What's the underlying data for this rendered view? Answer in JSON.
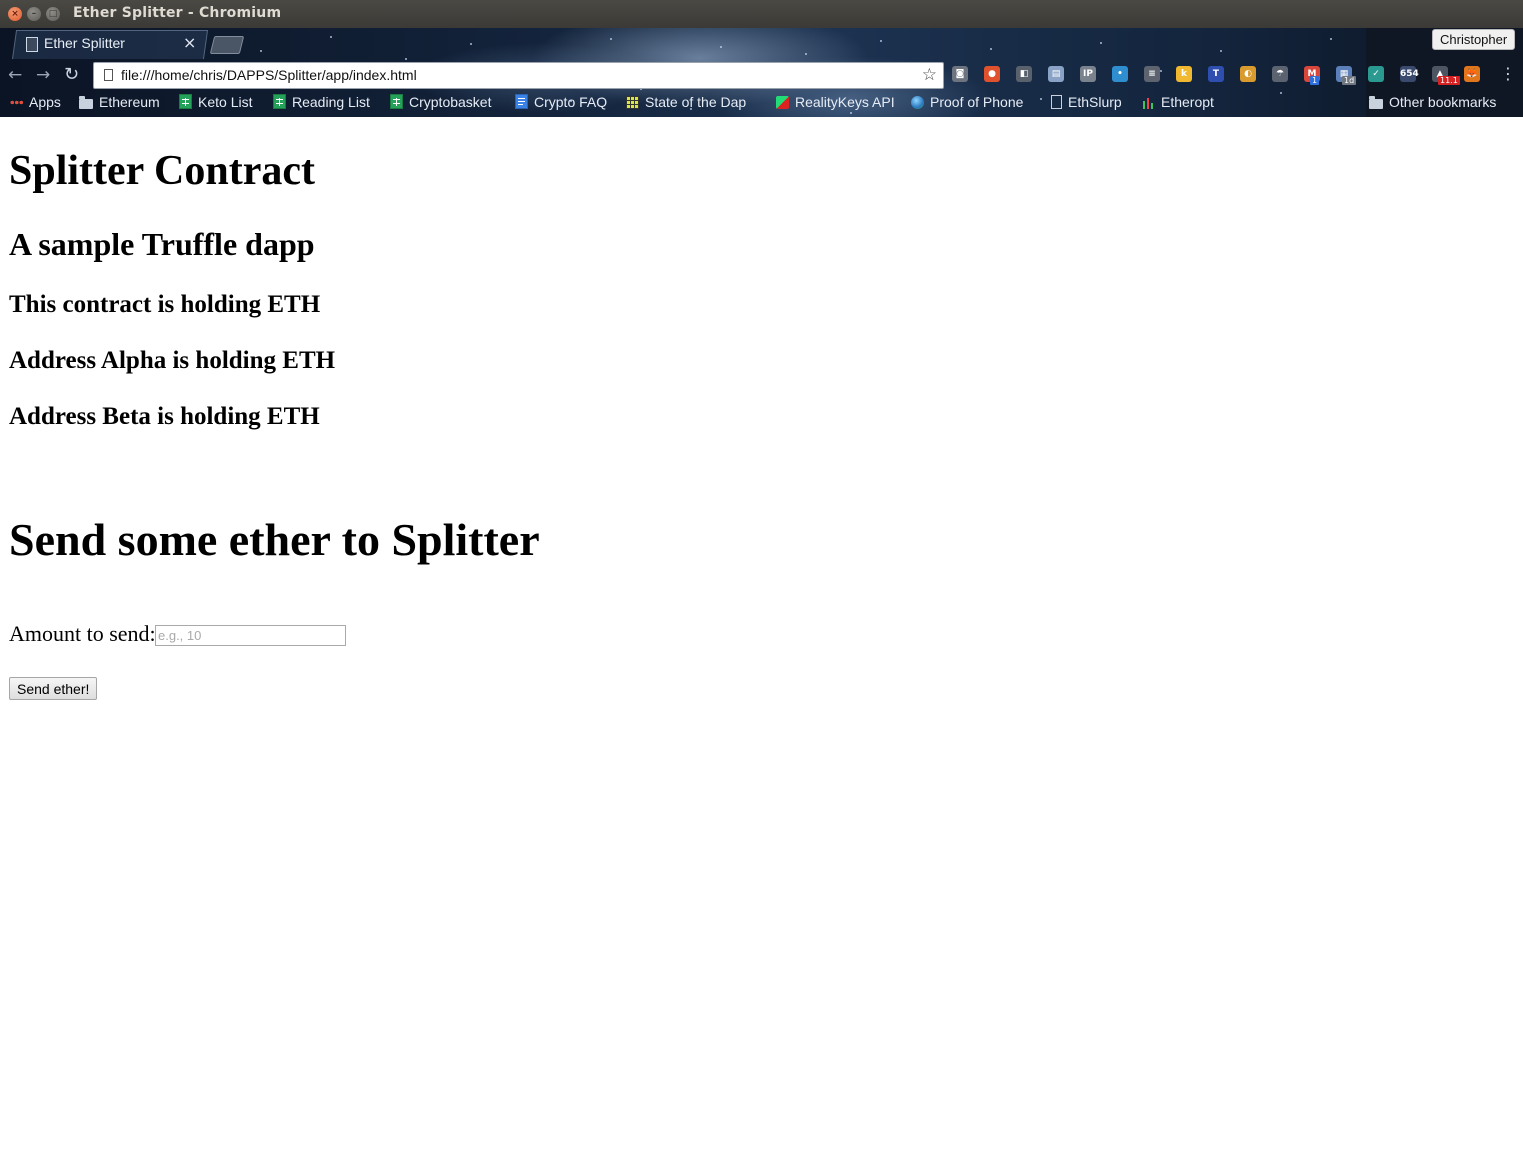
{
  "window": {
    "title": "Ether Splitter - Chromium",
    "controls": {
      "close": "×",
      "minimize": "–",
      "maximize": "□"
    }
  },
  "browser": {
    "tab": {
      "title": "Ether Splitter",
      "close_glyph": "×"
    },
    "profile_name": "Christopher",
    "address_bar": {
      "url": "file:///home/chris/DAPPS/Splitter/app/index.html"
    },
    "nav": {
      "back": "←",
      "forward": "→",
      "reload": "↻",
      "star": "☆",
      "menu": "⋮"
    },
    "extensions": [
      {
        "name": "pocket-icon",
        "glyph": "◙",
        "color": "#6d7480"
      },
      {
        "name": "brave-icon",
        "glyph": "●",
        "color": "#e0522e"
      },
      {
        "name": "reader-icon",
        "glyph": "◧",
        "color": "#59616d"
      },
      {
        "name": "doc-icon",
        "glyph": "▤",
        "color": "#8aa2c6"
      },
      {
        "name": "ip-icon",
        "glyph": "IP",
        "color": "#7a828e"
      },
      {
        "name": "dot-icon",
        "glyph": "•",
        "color": "#2f8ecf"
      },
      {
        "name": "database-icon",
        "glyph": "≡",
        "color": "#5d6470"
      },
      {
        "name": "keep-icon",
        "glyph": "k",
        "color": "#f0b930"
      },
      {
        "name": "trello-icon",
        "glyph": "T",
        "color": "#2f4fb0"
      },
      {
        "name": "color-wheel-icon",
        "glyph": "◐",
        "color": "#d99a2e"
      },
      {
        "name": "umbrella-icon",
        "glyph": "☂",
        "color": "#5b6270"
      },
      {
        "name": "gmail-icon",
        "glyph": "M",
        "color": "#d9463b",
        "badge": "1",
        "badge_color": "#2d6fe0"
      },
      {
        "name": "calendar-icon",
        "glyph": "▦",
        "color": "#5b7fb8",
        "badge": "1d",
        "badge_color": "#707780"
      },
      {
        "name": "checkmark-icon",
        "glyph": "✓",
        "color": "#2a9a90"
      },
      {
        "name": "counter-icon",
        "glyph": "654",
        "color": "#3a4a6e"
      },
      {
        "name": "alert-icon",
        "glyph": "▲",
        "color": "#4c5561",
        "badge": "11.1",
        "badge_color": "#d62222"
      },
      {
        "name": "metamask-icon",
        "glyph": "🦊",
        "color": "#e2761b"
      }
    ],
    "bookmarks": [
      {
        "label": "Apps",
        "icon": "apps-icon"
      },
      {
        "label": "Ethereum",
        "icon": "folder-icon"
      },
      {
        "label": "Keto List",
        "icon": "sheet-icon"
      },
      {
        "label": "Reading List",
        "icon": "sheet-icon"
      },
      {
        "label": "Cryptobasket",
        "icon": "sheet-icon"
      },
      {
        "label": "Crypto FAQ",
        "icon": "doc-icon"
      },
      {
        "label": "State of the Dap",
        "icon": "grid-icon"
      },
      {
        "label": "RealityKeys API",
        "icon": "realitykeys-icon"
      },
      {
        "label": "Proof of Phone",
        "icon": "globe-icon"
      },
      {
        "label": "EthSlurp",
        "icon": "page-icon"
      },
      {
        "label": "Etheropt",
        "icon": "bars-icon"
      },
      {
        "label": "Other bookmarks",
        "icon": "folder-icon"
      }
    ]
  },
  "page": {
    "title": "Splitter Contract",
    "subtitle": "A sample Truffle dapp",
    "contract_balance": "This contract is holding ETH",
    "alpha_balance": "Address Alpha is holding ETH",
    "beta_balance": "Address Beta is holding ETH",
    "send_heading": "Send some ether to Splitter",
    "amount_label": "Amount to send:",
    "amount_placeholder": "e.g., 10",
    "amount_value": "",
    "send_button": "Send ether!"
  }
}
